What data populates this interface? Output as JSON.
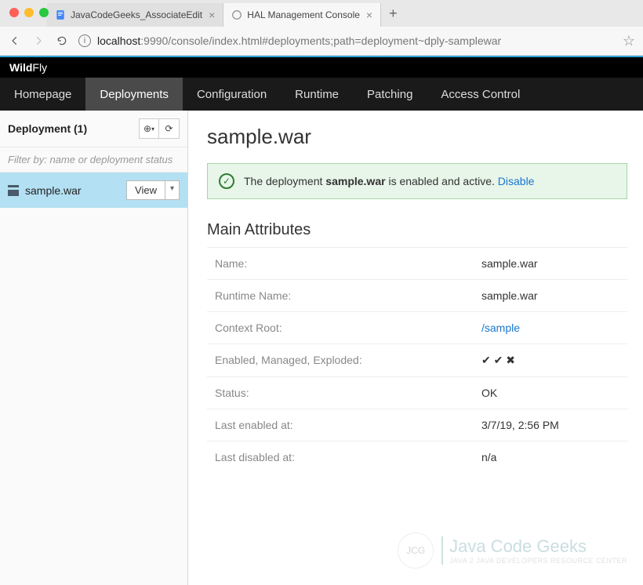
{
  "browser": {
    "tabs": [
      {
        "title": "JavaCodeGeeks_AssociateEdit",
        "active": false
      },
      {
        "title": "HAL Management Console",
        "active": true
      }
    ],
    "url_host": "localhost",
    "url_path": ":9990/console/index.html#deployments;path=deployment~dply-samplewar"
  },
  "brand": {
    "bold": "Wild",
    "thin": "Fly"
  },
  "nav": {
    "items": [
      "Homepage",
      "Deployments",
      "Configuration",
      "Runtime",
      "Patching",
      "Access Control"
    ],
    "active_index": 1
  },
  "sidebar": {
    "header": "Deployment (1)",
    "filter_placeholder": "Filter by: name or deployment status",
    "items": [
      {
        "name": "sample.war",
        "view_label": "View"
      }
    ]
  },
  "content": {
    "title": "sample.war",
    "alert": {
      "prefix": "The deployment ",
      "bold": "sample.war",
      "suffix": " is enabled and active. ",
      "link": "Disable"
    },
    "section_title": "Main Attributes",
    "attributes": [
      {
        "label": "Name:",
        "value": "sample.war",
        "type": "text"
      },
      {
        "label": "Runtime Name:",
        "value": "sample.war",
        "type": "text"
      },
      {
        "label": "Context Root:",
        "value": "/sample",
        "type": "link"
      },
      {
        "label": "Enabled, Managed, Exploded:",
        "value": "✔ ✔ ✖",
        "type": "icons"
      },
      {
        "label": "Status:",
        "value": "OK",
        "type": "text"
      },
      {
        "label": "Last enabled at:",
        "value": "3/7/19, 2:56 PM",
        "type": "text"
      },
      {
        "label": "Last disabled at:",
        "value": "n/a",
        "type": "text"
      }
    ]
  },
  "watermark": {
    "main": "Java Code Geeks",
    "sub": "JAVA 2 JAVA DEVELOPERS RESOURCE CENTER",
    "badge": "JCG"
  }
}
